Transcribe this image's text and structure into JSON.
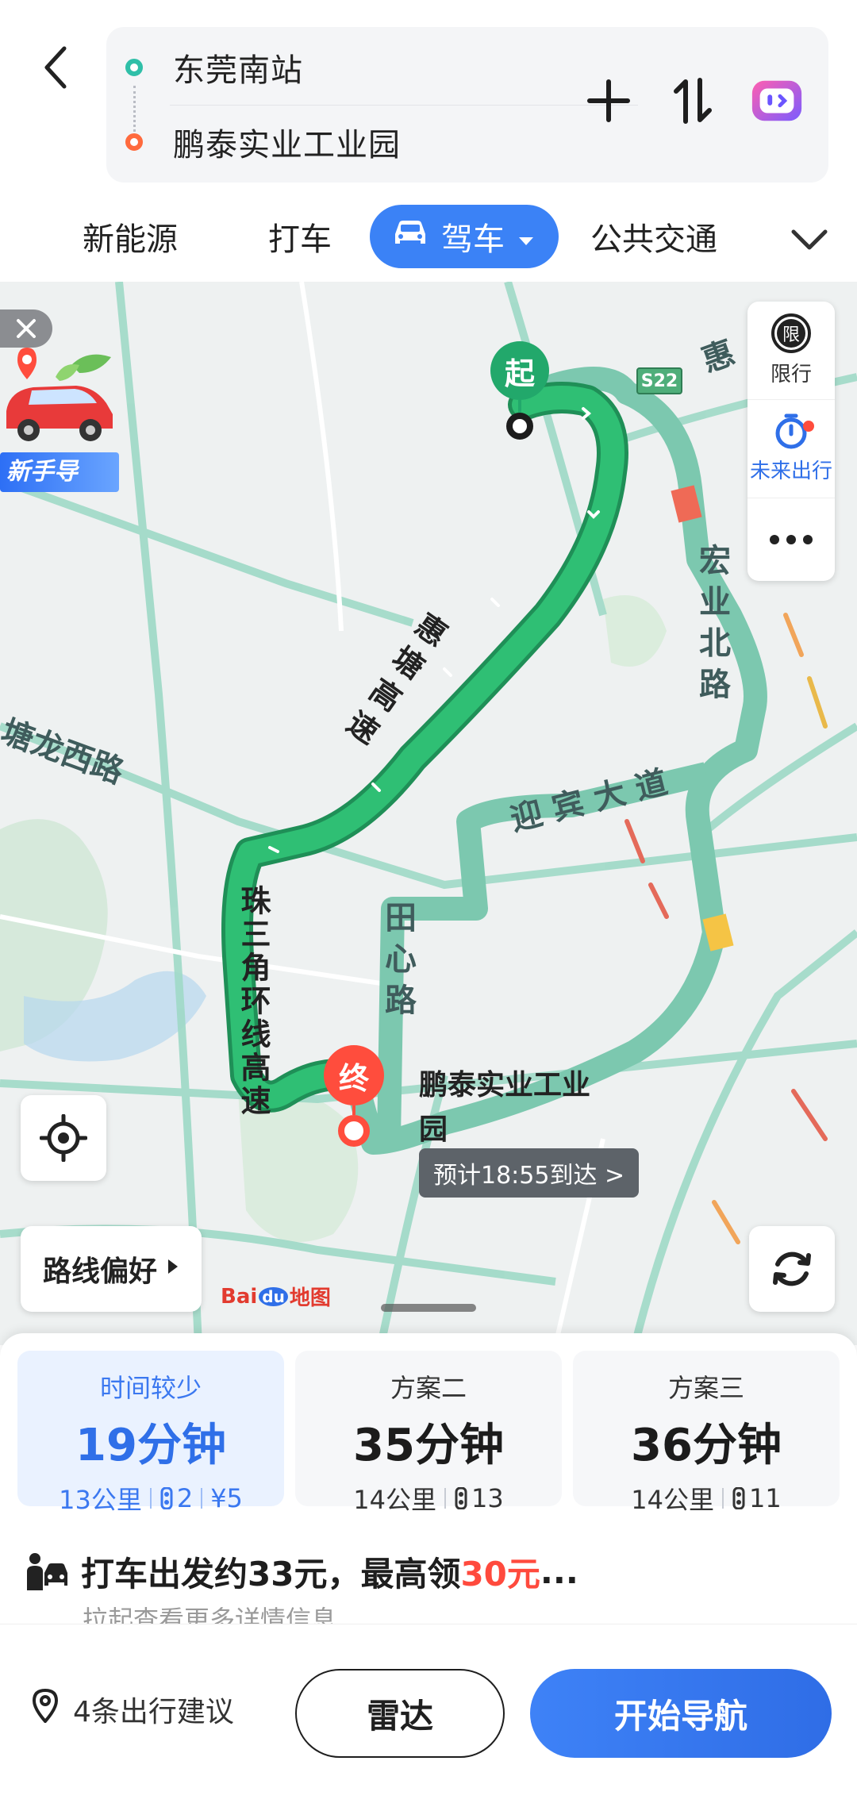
{
  "header": {
    "origin": "东莞南站",
    "destination": "鹏泰实业工业园"
  },
  "tabs": {
    "new_energy": "新能源",
    "taxi": "打车",
    "drive": "驾车",
    "transit": "公共交通"
  },
  "map": {
    "panel": {
      "restriction": "限行",
      "restriction_badge": "限",
      "future_trip": "未来出行"
    },
    "novice_label": "新手导",
    "start_marker": "起",
    "end_marker": "终",
    "destination_label": "鹏泰实业工业园",
    "eta": "预计18:55到达 >",
    "highway_shield": "S22",
    "roads": {
      "huitang": "惠塘高速",
      "pearl_ring": "珠三角环线高速",
      "hongye": "宏业北路",
      "yingbin": "迎宾大道",
      "tianxin": "田心路",
      "tanglong": "塘龙西路",
      "hui_partial": "惠"
    },
    "route_preference": "路线偏好",
    "logo": {
      "bai": "Bai",
      "du": "du",
      "map": "地图"
    }
  },
  "plans": [
    {
      "name": "时间较少",
      "time": "19分钟",
      "distance": "13公里",
      "lights": "2",
      "fee": "¥5",
      "active": true
    },
    {
      "name": "方案二",
      "time": "35分钟",
      "distance": "14公里",
      "lights": "13",
      "active": false
    },
    {
      "name": "方案三",
      "time": "36分钟",
      "distance": "14公里",
      "lights": "11",
      "active": false
    }
  ],
  "taxi": {
    "prefix": "打车出发约33元，最高领",
    "highlight": "30元",
    "suffix": "...",
    "sub": "拉起查看更多详情信息"
  },
  "bottom": {
    "suggestions": "4条出行建议",
    "radar": "雷达",
    "start_nav": "开始导航"
  },
  "colors": {
    "accent": "#3b82f6",
    "route_main": "#2bb673",
    "route_alt": "#6fc3a8",
    "highlight_red": "#ff4a3d"
  }
}
